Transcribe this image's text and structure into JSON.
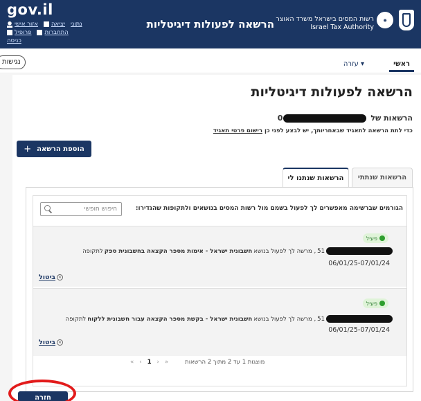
{
  "header": {
    "gov_logo": "gov.il",
    "user_links_row1": [
      "אזור",
      "יציאה",
      "נתוני",
      "אישי"
    ],
    "user_links_row2": [
      "פרופיל",
      "התחברות",
      "כניסה"
    ],
    "link_personal_area": "אזור אישי",
    "link_logout": "יציאה",
    "link_data": "נתוני",
    "link_profile": "פרופיל",
    "link_login": "התחברות",
    "link_enter": "כניסה",
    "site_title": "הרשאה לפעולות דיגיטליות",
    "authority_line1": "רשות המסים בישראל משרד האוצר",
    "authority_line2": "Israel Tax Authority"
  },
  "nav": {
    "home": "ראשי",
    "help": "עזרה ▾",
    "accessibility": "נגישות"
  },
  "main": {
    "title": "הרשאה לפעולות דיגיטליות",
    "perm_of_label": "הרשאות של",
    "perm_of_value_prefix": "0",
    "notice_text": "כדי לתת הרשאה לתאגיד שבאחריותך, יש לבצע לפני כן",
    "notice_link": "רישום פרטי תאגיד",
    "add_button": "הוספת הרשאה",
    "add_button_plus": "+",
    "tabs": {
      "given": "הרשאות שנתתי",
      "received": "הרשאות שנתנו לי"
    },
    "panel_description": "הגורמים שברשימה מאפשרים לך לפעול בשמם מול רשות המסים בנושאים ולתקופות שהגדירו:",
    "search_placeholder": "חיפוש חופשי",
    "items": [
      {
        "status": "פעיל",
        "num_prefix": "51",
        "text_before": ", מרשה לך לפעול בנושא",
        "topic": "חשבונית ישראל - אימות מספר הקצאה בחשבונית ספק",
        "text_after": "לתקופה",
        "dates": "06/01/25-07/01/24",
        "cancel": "ביטול"
      },
      {
        "status": "פעיל",
        "num_prefix": "51",
        "text_before": ", מרשה לך לפעול בנושא",
        "topic": "חשבונית ישראל - בקשת מספר הקצאה עבור חשבונית ללקוח",
        "text_after": "לתקופה",
        "dates": "06/01/25-07/01/24",
        "cancel": "ביטול"
      }
    ],
    "pager": {
      "first": "«",
      "prev": "‹",
      "current": "1",
      "next": "›",
      "last": "»",
      "summary": "מוצגות 1 עד 2 מתוך 2 הרשאות"
    },
    "back_button": "חזרה"
  },
  "colors": {
    "brand_navy": "#1b3663",
    "active_green": "#2e9e2e",
    "annotation_red": "#e21b1b"
  }
}
